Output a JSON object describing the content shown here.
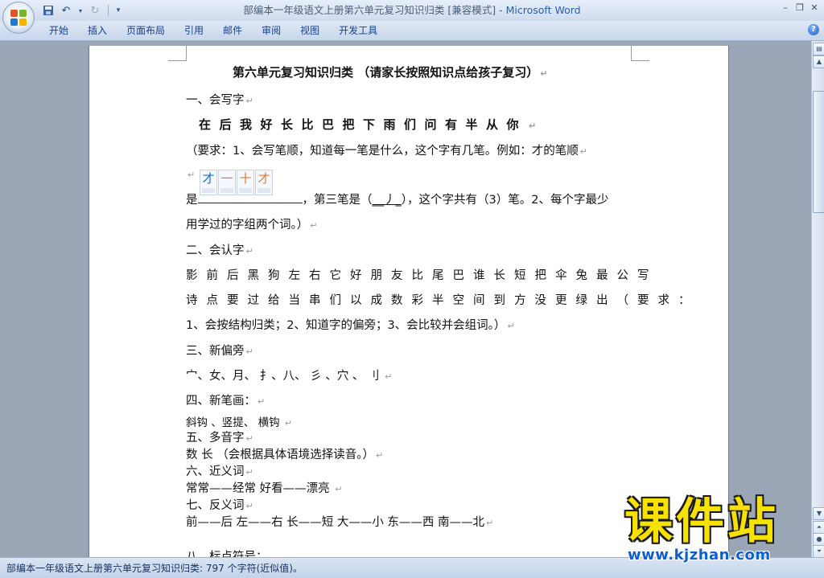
{
  "window": {
    "title": "部编本一年级语文上册第六单元复习知识归类 [兼容模式] - ",
    "app_name": "Microsoft Word",
    "minimize": "–",
    "restore": "❐",
    "close": "✕"
  },
  "ribbon": {
    "tabs": [
      "开始",
      "插入",
      "页面布局",
      "引用",
      "邮件",
      "审阅",
      "视图",
      "开发工具"
    ],
    "help": "?"
  },
  "document": {
    "title": "第六单元复习知识归类 （请家长按照知识点给孩子复习）",
    "s1_heading": "一、会写字",
    "s1_chars": "在后我好长比巴把下雨们问有半从你",
    "s1_req_line1": "（要求：1、会写笔顺，知道每一笔是什么，这个字有几笔。例如：才的笔顺",
    "s1_stroke_glyphs": [
      "才",
      "一",
      "十",
      "才"
    ],
    "s1_req_prefix": "是",
    "s1_req_mid1": "，第三笔是（",
    "s1_req_answer": "__丿_",
    "s1_req_mid2": "），这个字共有（3）笔。2、每个字最少",
    "s1_req_line3": "用学过的字组两个词。）",
    "s2_heading": "二、会认字",
    "s2_chars_1": "影前后黑狗左右它好朋友比尾巴谁长短把伞兔最公写",
    "s2_chars_2": "诗点要过给当串们以成数彩半空间到方没更绿出（要求：",
    "s2_req": "1、会按结构归类；2、知道字的偏旁；3、会比较并会组词。）",
    "s3_heading": "三、新偏旁",
    "s3_content": " 宀、女、月、 扌、八、 彡 、穴 、 刂 ",
    "s4_heading": "四、新笔画：",
    "s4_content": "斜钩  、竖提、  横钩 ",
    "s5_heading": "五、多音字",
    "s5_content": " 数   长  （会根据具体语境选择读音。）",
    "s6_heading": "六、近义词",
    "s6_content": "  常常——经常      好看——漂亮   ",
    "s7_heading": "七、反义词",
    "s7_content": "  前——后   左——右     长——短   大——小     东——西     南——北",
    "s8_heading": "八、标点符号：",
    "paragraph_mark": "↵"
  },
  "status": {
    "text": "部编本一年级语文上册第六单元复习知识归类: 797 个字符(近似值)。"
  },
  "watermark": {
    "logo_text": "课件站",
    "url": "www.kjzhan.com"
  }
}
